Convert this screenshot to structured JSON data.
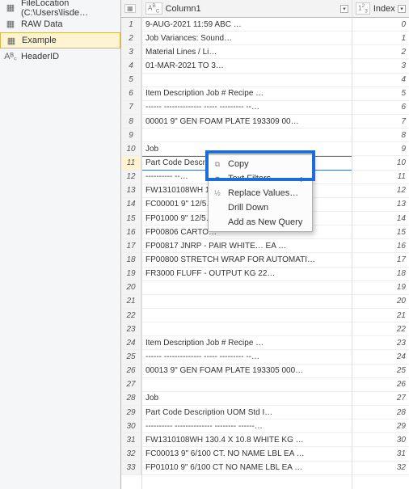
{
  "sidebar": {
    "items": [
      {
        "label": "FileLocation (C:\\Users\\lisde…",
        "icon": "table"
      },
      {
        "label": "RAW Data",
        "icon": "table"
      },
      {
        "label": "Example",
        "icon": "table"
      },
      {
        "label": "HeaderID",
        "icon": "abc"
      }
    ],
    "selected_index": 2
  },
  "columns": {
    "col1": {
      "type_label": "A",
      "sup": "B",
      "sub": "C",
      "name": "Column1"
    },
    "col2": {
      "type_label": "1",
      "sup": "2",
      "sub": "3",
      "name": "Index"
    }
  },
  "rows": [
    {
      "n": 1,
      "c1": "9-AUG-2021 11:59                     ABC …",
      "c2": "0"
    },
    {
      "n": 2,
      "c1": "                         Job Variances: Sound…",
      "c2": "1"
    },
    {
      "n": 3,
      "c1": "                         Material Lines / Li…",
      "c2": "2"
    },
    {
      "n": 4,
      "c1": "                         01-MAR-2021 TO 3…",
      "c2": "3"
    },
    {
      "n": 5,
      "c1": "",
      "c2": "4"
    },
    {
      "n": 6,
      "c1": "Item       Description       Job #  Recipe       …",
      "c2": "5"
    },
    {
      "n": 7,
      "c1": "------      --------------      -----   ---------    --…",
      "c2": "6"
    },
    {
      "n": 8,
      "c1": "00001     9\" GEN FOAM PLATE        193309 00…",
      "c2": "7"
    },
    {
      "n": 9,
      "c1": "",
      "c2": "8"
    },
    {
      "n": 10,
      "c1": "                                  Job",
      "c2": "9"
    },
    {
      "n": 11,
      "c1": "Part Code   Description          UOM     Std I…",
      "c2": "10"
    },
    {
      "n": 12,
      "c1": "----------    --…",
      "c2": "11"
    },
    {
      "n": 13,
      "c1": "FW1310108WH  13…",
      "c2": "12"
    },
    {
      "n": 14,
      "c1": "FC00001    9\" 12/5…",
      "c2": "13"
    },
    {
      "n": 15,
      "c1": "FP01000    9\" 12/5…",
      "c2": "14"
    },
    {
      "n": 16,
      "c1": "FP00806    CARTO…",
      "c2": "15"
    },
    {
      "n": 17,
      "c1": "FP00817    JNRP -  PAIR WHITE…    EA    …",
      "c2": "16"
    },
    {
      "n": 18,
      "c1": "FP00800    STRETCH WRAP FOR AUTOMATI…",
      "c2": "17"
    },
    {
      "n": 19,
      "c1": "FR3000     FLUFF - OUTPUT       KG     22…",
      "c2": "18"
    },
    {
      "n": 20,
      "c1": "",
      "c2": "19"
    },
    {
      "n": 21,
      "c1": "",
      "c2": "20"
    },
    {
      "n": 22,
      "c1": "",
      "c2": "21"
    },
    {
      "n": 23,
      "c1": "",
      "c2": "22"
    },
    {
      "n": 24,
      "c1": "Item       Description       Job #  Recipe       …",
      "c2": "23"
    },
    {
      "n": 25,
      "c1": "------      --------------      -----   ---------    --…",
      "c2": "24"
    },
    {
      "n": 26,
      "c1": "00013     9\" GEN FOAM PLATE        193305 000…",
      "c2": "25"
    },
    {
      "n": 27,
      "c1": "",
      "c2": "26"
    },
    {
      "n": 28,
      "c1": "                                  Job",
      "c2": "27"
    },
    {
      "n": 29,
      "c1": "Part Code   Description          UOM    Std I…",
      "c2": "28"
    },
    {
      "n": 30,
      "c1": "----------    --------------        --------   ------…",
      "c2": "29"
    },
    {
      "n": 31,
      "c1": "FW1310108WH  130.4 X 10.8     WHITE KG  …",
      "c2": "30"
    },
    {
      "n": 32,
      "c1": "FC00013    9\" 6/100 CT. NO NAME LBL  EA  …",
      "c2": "31"
    },
    {
      "n": 33,
      "c1": "FP01010    9\" 6/100 CT NO NAME LBL  EA  …",
      "c2": "32"
    }
  ],
  "selected_row": 11,
  "context_menu": {
    "items": [
      {
        "icon": "⧉",
        "label": "Copy"
      },
      {
        "icon": "▼",
        "label": "Text Filters",
        "arrow": true
      },
      {
        "icon": "½",
        "label": "Replace Values…"
      },
      {
        "icon": "",
        "label": "Drill Down"
      },
      {
        "icon": "",
        "label": "Add as New Query"
      }
    ]
  }
}
